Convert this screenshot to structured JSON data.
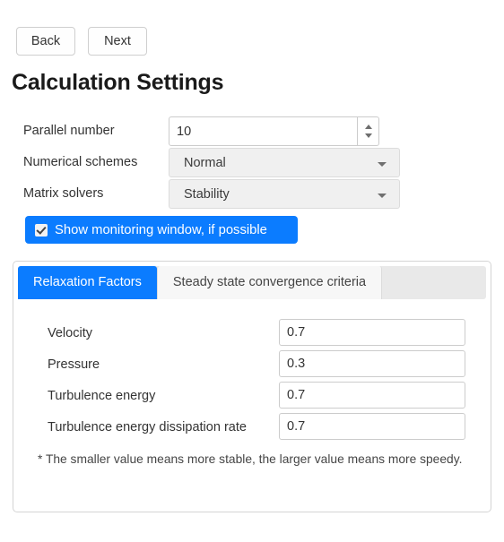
{
  "nav": {
    "back_label": "Back",
    "next_label": "Next"
  },
  "page_title": "Calculation Settings",
  "settings": {
    "parallel_number": {
      "label": "Parallel number",
      "value": "10"
    },
    "numerical_schemes": {
      "label": "Numerical schemes",
      "value": "Normal"
    },
    "matrix_solvers": {
      "label": "Matrix solvers",
      "value": "Stability"
    }
  },
  "monitoring": {
    "label": "Show monitoring window, if possible",
    "checked": true
  },
  "panel": {
    "tabs": [
      {
        "label": "Relaxation Factors",
        "active": true
      },
      {
        "label": "Steady state convergence criteria",
        "active": false
      }
    ],
    "fields": [
      {
        "label": "Velocity",
        "value": "0.7"
      },
      {
        "label": "Pressure",
        "value": "0.3"
      },
      {
        "label": "Turbulence energy",
        "value": "0.7"
      },
      {
        "label": "Turbulence energy dissipation rate",
        "value": "0.7"
      }
    ],
    "note": "* The smaller value means more stable, the larger value means more speedy."
  },
  "colors": {
    "accent": "#0b7cff",
    "panel_border": "#d4d4d4",
    "tabstrip_bg": "#e9e9e9",
    "select_bg": "#f0f0f0"
  }
}
